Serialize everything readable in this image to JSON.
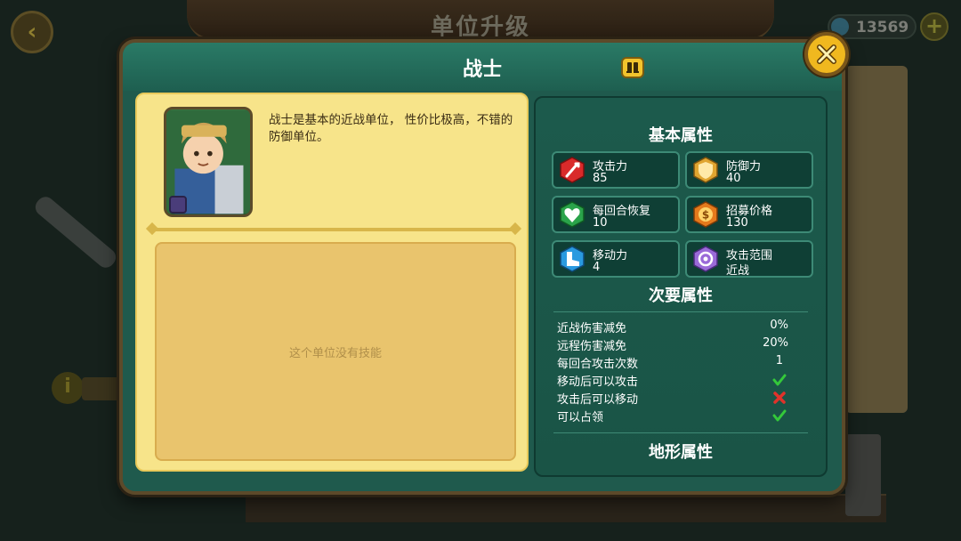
{
  "background": {
    "title": "单位升级",
    "currency_value": "13569"
  },
  "modal": {
    "title": "战士",
    "description": "战士是基本的近战单位， 性价比极高，不错的防御单位。",
    "no_skills_text": "这个单位没有技能"
  },
  "basic_stats": {
    "heading": "基本属性",
    "items": [
      {
        "label": "攻击力",
        "value": "85",
        "icon": "attack-icon"
      },
      {
        "label": "防御力",
        "value": "40",
        "icon": "defense-icon"
      },
      {
        "label": "每回合恢复",
        "value": "10",
        "icon": "heal-icon"
      },
      {
        "label": "招募价格",
        "value": "130",
        "icon": "coin-icon"
      },
      {
        "label": "移动力",
        "value": "4",
        "icon": "boot-icon"
      },
      {
        "label": "攻击范围",
        "value": "近战",
        "icon": "range-icon"
      }
    ]
  },
  "secondary_stats": {
    "heading": "次要属性",
    "rows": [
      {
        "label": "近战伤害减免",
        "value": "0%"
      },
      {
        "label": "远程伤害减免",
        "value": "20%"
      },
      {
        "label": "每回合攻击次数",
        "value": "1"
      },
      {
        "label": "移动后可以攻击",
        "status": "yes"
      },
      {
        "label": "攻击后可以移动",
        "status": "no"
      },
      {
        "label": "可以占领",
        "status": "yes"
      }
    ]
  },
  "terrain_stats": {
    "heading": "地形属性"
  },
  "colors": {
    "panel_green": "#1f5a4d",
    "parchment": "#f7e48a",
    "check_green": "#34c93a",
    "cross_red": "#e0322a",
    "gold": "#f0b81f"
  }
}
